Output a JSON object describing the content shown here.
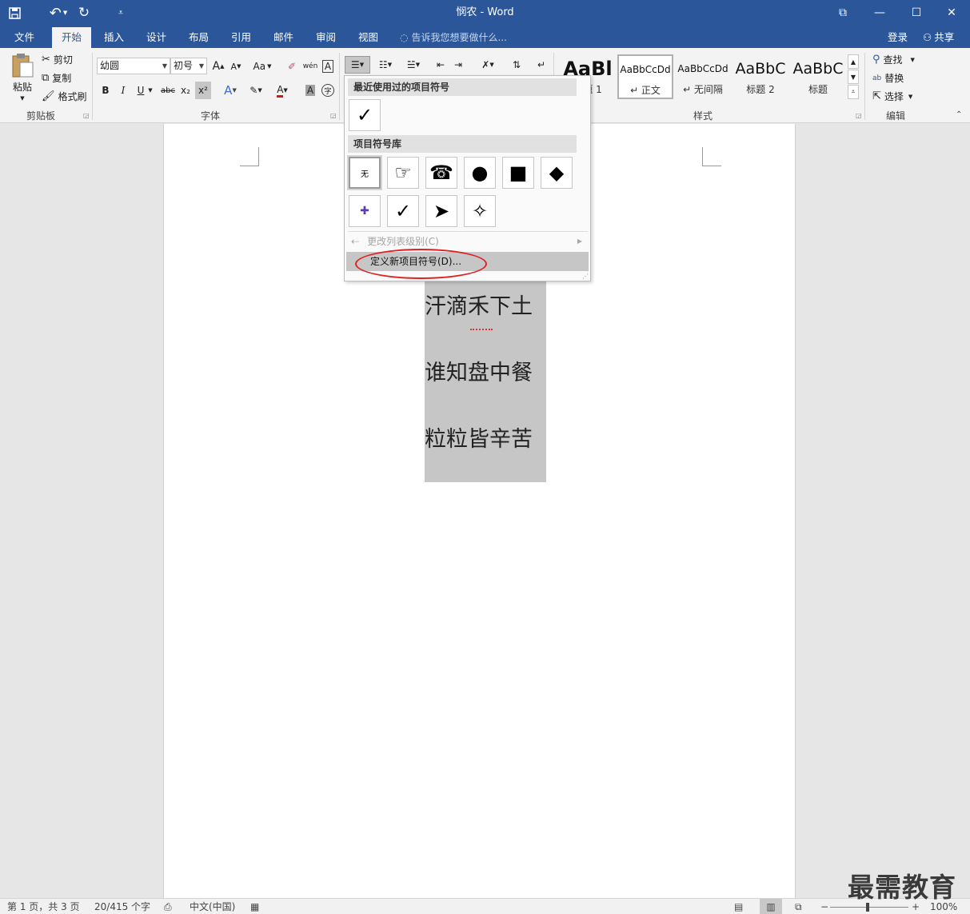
{
  "titlebar": {
    "title": "悯农 - Word",
    "undo_glyph": "↶",
    "redo_glyph": "↻",
    "qat_more_glyph": "⩡",
    "restore_glyph": "⧉",
    "minimize_glyph": "—",
    "maximize_glyph": "☐",
    "close_glyph": "✕"
  },
  "tabs": [
    {
      "label": "文件"
    },
    {
      "label": "开始"
    },
    {
      "label": "插入"
    },
    {
      "label": "设计"
    },
    {
      "label": "布局"
    },
    {
      "label": "引用"
    },
    {
      "label": "邮件"
    },
    {
      "label": "审阅"
    },
    {
      "label": "视图"
    }
  ],
  "tellme": "告诉我您想要做什么...",
  "login": "登录",
  "share": "共享",
  "ribbon": {
    "clipboard": {
      "paste": "粘贴",
      "cut": "剪切",
      "copy": "复制",
      "format_painter": "格式刷",
      "label": "剪贴板"
    },
    "font": {
      "font_name": "幼圆",
      "font_size": "初号",
      "grow": "A",
      "shrink": "A",
      "change_case": "Aa",
      "bold": "B",
      "italic": "I",
      "underline": "U",
      "strike": "abc",
      "sub": "x₂",
      "sup": "x²",
      "label": "字体"
    },
    "styles": {
      "items": [
        {
          "sample": "AaBl",
          "name": "标题 1"
        },
        {
          "sample": "AaBbCcDd",
          "name": "↵ 正文"
        },
        {
          "sample": "AaBbCcDd",
          "name": "↵ 无间隔"
        },
        {
          "sample": "AaBbC",
          "name": "标题 2"
        },
        {
          "sample": "AaBbC",
          "name": "标题"
        }
      ],
      "label": "样式"
    },
    "editing": {
      "find": "查找",
      "replace": "替换",
      "select": "选择",
      "label": "编辑"
    }
  },
  "bullet_menu": {
    "recent_header": "最近使用过的项目符号",
    "recent": [
      "✓"
    ],
    "library_header": "项目符号库",
    "library": [
      "无",
      "☞",
      "☎",
      "●",
      "■",
      "◆",
      "✚",
      "✓",
      "➤",
      "✧"
    ],
    "change_level": "更改列表级别(C)",
    "define_new": "定义新项目符号(D)..."
  },
  "document": {
    "lines": [
      "汗滴禾下土",
      "谁知盘中餐",
      "粒粒皆辛苦"
    ]
  },
  "status": {
    "page": "第 1 页，共 3 页",
    "words": "20/415 个字",
    "language": "中文(中国)",
    "zoom": "100%"
  },
  "watermark": "最需教育"
}
